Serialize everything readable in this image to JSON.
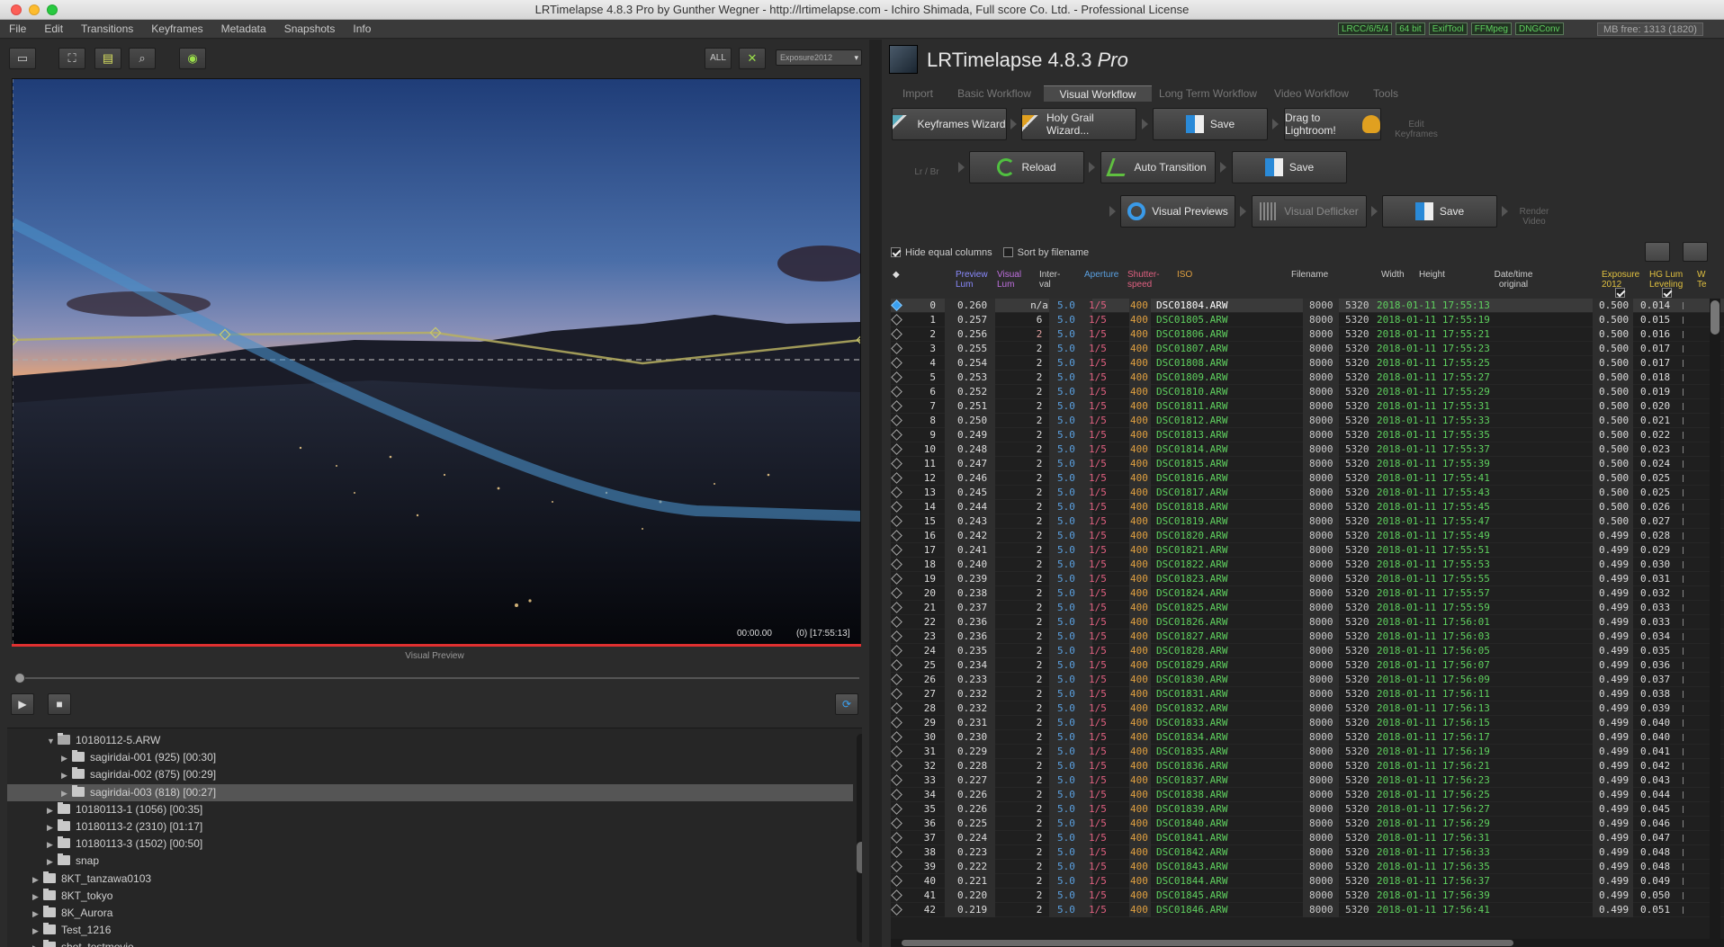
{
  "window": {
    "title": "LRTimelapse 4.8.3 Pro by Gunther Wegner - http://lrtimelapse.com - Ichiro Shimada, Full score Co. Ltd. - Professional License"
  },
  "menu": [
    "File",
    "Edit",
    "Transitions",
    "Keyframes",
    "Metadata",
    "Snapshots",
    "Info"
  ],
  "status_badges": [
    "LRCC/6/5/4",
    "64 bit",
    "ExifTool",
    "FFMpeg",
    "DNGConv"
  ],
  "memory": "MB free: 1313 (1820)",
  "left_toolbar": {
    "all_label": "ALL",
    "dropdown_value": "Exposure2012"
  },
  "preview": {
    "time": "00:00.00",
    "frame_info": "(0) [17:55:13]",
    "label": "Visual Preview",
    "slider_position": 0
  },
  "tree": [
    {
      "label": "10180112-5.ARW",
      "indent": 3,
      "open": true,
      "selected": false
    },
    {
      "label": "sagiridai-001 (925) [00:30]",
      "indent": 4,
      "open": false,
      "selected": false
    },
    {
      "label": "sagiridai-002 (875) [00:29]",
      "indent": 4,
      "open": false,
      "selected": false
    },
    {
      "label": "sagiridai-003 (818) [00:27]",
      "indent": 4,
      "open": false,
      "selected": true
    },
    {
      "label": "10180113-1 (1056) [00:35]",
      "indent": 3,
      "open": false,
      "selected": false
    },
    {
      "label": "10180113-2 (2310) [01:17]",
      "indent": 3,
      "open": false,
      "selected": false
    },
    {
      "label": "10180113-3 (1502) [00:50]",
      "indent": 3,
      "open": false,
      "selected": false
    },
    {
      "label": "snap",
      "indent": 3,
      "open": false,
      "selected": false
    },
    {
      "label": "8KT_tanzawa0103",
      "indent": 2,
      "open": false,
      "selected": false
    },
    {
      "label": "8KT_tokyo",
      "indent": 2,
      "open": false,
      "selected": false
    },
    {
      "label": "8K_Aurora",
      "indent": 2,
      "open": false,
      "selected": false
    },
    {
      "label": "Test_1216",
      "indent": 2,
      "open": false,
      "selected": false
    },
    {
      "label": "shot_testmovie",
      "indent": 2,
      "open": false,
      "selected": false
    }
  ],
  "app": {
    "name": "LRTimelapse 4.8.3",
    "edition": "Pro"
  },
  "workflow_tabs": [
    "Import",
    "Basic Workflow",
    "Visual Workflow",
    "Long Term Workflow",
    "Video Workflow",
    "Tools"
  ],
  "active_tab": "Visual Workflow",
  "workflow": {
    "keyframes_wizard": "Keyframes Wizard",
    "holy_grail_wizard": "Holy Grail Wizard...",
    "save1": "Save",
    "drag_to_lightroom": "Drag to Lightroom!",
    "edit_keyframes": "Edit Keyframes",
    "lr_br": "Lr / Br",
    "reload": "Reload",
    "auto_transition": "Auto Transition",
    "save2": "Save",
    "visual_previews": "Visual Previews",
    "visual_deflicker": "Visual Deflicker",
    "save3": "Save",
    "render_video": "Render Video"
  },
  "options": {
    "hide_equal_columns": "Hide equal columns",
    "hide_equal_checked": true,
    "sort_by_filename": "Sort by filename",
    "sort_checked": false
  },
  "table": {
    "headers": {
      "keyframe": "◆",
      "preview_lum": "Preview Lum",
      "visual_lum": "Visual Lum",
      "interval": "Inter- val",
      "aperture": "Aperture",
      "shutter": "Shutter- speed",
      "iso": "ISO",
      "filename": "Filename",
      "width": "Width",
      "height": "Height",
      "datetime": "Date/time original",
      "exposure": "Exposure 2012",
      "hglum": "HG Lum Leveling",
      "wb": "W Te"
    },
    "colors": {
      "preview_lum": "#8a8aff",
      "visual_lum": "#c070e0",
      "aperture": "#5aa0e0",
      "shutter": "#e06080",
      "iso": "#e0a040",
      "exposure": "#e0c040",
      "datetime_text": "#5fd05f"
    },
    "rows": [
      {
        "n": "0",
        "lum": "0.260",
        "int": "n/a",
        "ap": "5.0",
        "sh": "1/5",
        "iso": "400",
        "file": "DSC01804.ARW",
        "w": "8000",
        "h": "5320",
        "dt": "2018-01-11 17:55:13",
        "exp": "0.500",
        "hg": "0.014",
        "kf": true
      },
      {
        "n": "1",
        "lum": "0.257",
        "int": "6",
        "ap": "5.0",
        "sh": "1/5",
        "iso": "400",
        "file": "DSC01805.ARW",
        "w": "8000",
        "h": "5320",
        "dt": "2018-01-11 17:55:19",
        "exp": "0.500",
        "hg": "0.015",
        "kf": false
      },
      {
        "n": "2",
        "lum": "0.256",
        "int": "2",
        "ap": "5.0",
        "sh": "1/5",
        "iso": "400",
        "file": "DSC01806.ARW",
        "w": "8000",
        "h": "5320",
        "dt": "2018-01-11 17:55:21",
        "exp": "0.500",
        "hg": "0.016",
        "kf": false
      },
      {
        "n": "3",
        "lum": "0.255",
        "int": "2",
        "ap": "5.0",
        "sh": "1/5",
        "iso": "400",
        "file": "DSC01807.ARW",
        "w": "8000",
        "h": "5320",
        "dt": "2018-01-11 17:55:23",
        "exp": "0.500",
        "hg": "0.017",
        "kf": false
      },
      {
        "n": "4",
        "lum": "0.254",
        "int": "2",
        "ap": "5.0",
        "sh": "1/5",
        "iso": "400",
        "file": "DSC01808.ARW",
        "w": "8000",
        "h": "5320",
        "dt": "2018-01-11 17:55:25",
        "exp": "0.500",
        "hg": "0.017",
        "kf": false
      },
      {
        "n": "5",
        "lum": "0.253",
        "int": "2",
        "ap": "5.0",
        "sh": "1/5",
        "iso": "400",
        "file": "DSC01809.ARW",
        "w": "8000",
        "h": "5320",
        "dt": "2018-01-11 17:55:27",
        "exp": "0.500",
        "hg": "0.018",
        "kf": false
      },
      {
        "n": "6",
        "lum": "0.252",
        "int": "2",
        "ap": "5.0",
        "sh": "1/5",
        "iso": "400",
        "file": "DSC01810.ARW",
        "w": "8000",
        "h": "5320",
        "dt": "2018-01-11 17:55:29",
        "exp": "0.500",
        "hg": "0.019",
        "kf": false
      },
      {
        "n": "7",
        "lum": "0.251",
        "int": "2",
        "ap": "5.0",
        "sh": "1/5",
        "iso": "400",
        "file": "DSC01811.ARW",
        "w": "8000",
        "h": "5320",
        "dt": "2018-01-11 17:55:31",
        "exp": "0.500",
        "hg": "0.020",
        "kf": false
      },
      {
        "n": "8",
        "lum": "0.250",
        "int": "2",
        "ap": "5.0",
        "sh": "1/5",
        "iso": "400",
        "file": "DSC01812.ARW",
        "w": "8000",
        "h": "5320",
        "dt": "2018-01-11 17:55:33",
        "exp": "0.500",
        "hg": "0.021",
        "kf": false
      },
      {
        "n": "9",
        "lum": "0.249",
        "int": "2",
        "ap": "5.0",
        "sh": "1/5",
        "iso": "400",
        "file": "DSC01813.ARW",
        "w": "8000",
        "h": "5320",
        "dt": "2018-01-11 17:55:35",
        "exp": "0.500",
        "hg": "0.022",
        "kf": false
      },
      {
        "n": "10",
        "lum": "0.248",
        "int": "2",
        "ap": "5.0",
        "sh": "1/5",
        "iso": "400",
        "file": "DSC01814.ARW",
        "w": "8000",
        "h": "5320",
        "dt": "2018-01-11 17:55:37",
        "exp": "0.500",
        "hg": "0.023",
        "kf": false
      },
      {
        "n": "11",
        "lum": "0.247",
        "int": "2",
        "ap": "5.0",
        "sh": "1/5",
        "iso": "400",
        "file": "DSC01815.ARW",
        "w": "8000",
        "h": "5320",
        "dt": "2018-01-11 17:55:39",
        "exp": "0.500",
        "hg": "0.024",
        "kf": false
      },
      {
        "n": "12",
        "lum": "0.246",
        "int": "2",
        "ap": "5.0",
        "sh": "1/5",
        "iso": "400",
        "file": "DSC01816.ARW",
        "w": "8000",
        "h": "5320",
        "dt": "2018-01-11 17:55:41",
        "exp": "0.500",
        "hg": "0.025",
        "kf": false
      },
      {
        "n": "13",
        "lum": "0.245",
        "int": "2",
        "ap": "5.0",
        "sh": "1/5",
        "iso": "400",
        "file": "DSC01817.ARW",
        "w": "8000",
        "h": "5320",
        "dt": "2018-01-11 17:55:43",
        "exp": "0.500",
        "hg": "0.025",
        "kf": false
      },
      {
        "n": "14",
        "lum": "0.244",
        "int": "2",
        "ap": "5.0",
        "sh": "1/5",
        "iso": "400",
        "file": "DSC01818.ARW",
        "w": "8000",
        "h": "5320",
        "dt": "2018-01-11 17:55:45",
        "exp": "0.500",
        "hg": "0.026",
        "kf": false
      },
      {
        "n": "15",
        "lum": "0.243",
        "int": "2",
        "ap": "5.0",
        "sh": "1/5",
        "iso": "400",
        "file": "DSC01819.ARW",
        "w": "8000",
        "h": "5320",
        "dt": "2018-01-11 17:55:47",
        "exp": "0.500",
        "hg": "0.027",
        "kf": false
      },
      {
        "n": "16",
        "lum": "0.242",
        "int": "2",
        "ap": "5.0",
        "sh": "1/5",
        "iso": "400",
        "file": "DSC01820.ARW",
        "w": "8000",
        "h": "5320",
        "dt": "2018-01-11 17:55:49",
        "exp": "0.499",
        "hg": "0.028",
        "kf": false
      },
      {
        "n": "17",
        "lum": "0.241",
        "int": "2",
        "ap": "5.0",
        "sh": "1/5",
        "iso": "400",
        "file": "DSC01821.ARW",
        "w": "8000",
        "h": "5320",
        "dt": "2018-01-11 17:55:51",
        "exp": "0.499",
        "hg": "0.029",
        "kf": false
      },
      {
        "n": "18",
        "lum": "0.240",
        "int": "2",
        "ap": "5.0",
        "sh": "1/5",
        "iso": "400",
        "file": "DSC01822.ARW",
        "w": "8000",
        "h": "5320",
        "dt": "2018-01-11 17:55:53",
        "exp": "0.499",
        "hg": "0.030",
        "kf": false
      },
      {
        "n": "19",
        "lum": "0.239",
        "int": "2",
        "ap": "5.0",
        "sh": "1/5",
        "iso": "400",
        "file": "DSC01823.ARW",
        "w": "8000",
        "h": "5320",
        "dt": "2018-01-11 17:55:55",
        "exp": "0.499",
        "hg": "0.031",
        "kf": false
      },
      {
        "n": "20",
        "lum": "0.238",
        "int": "2",
        "ap": "5.0",
        "sh": "1/5",
        "iso": "400",
        "file": "DSC01824.ARW",
        "w": "8000",
        "h": "5320",
        "dt": "2018-01-11 17:55:57",
        "exp": "0.499",
        "hg": "0.032",
        "kf": false
      },
      {
        "n": "21",
        "lum": "0.237",
        "int": "2",
        "ap": "5.0",
        "sh": "1/5",
        "iso": "400",
        "file": "DSC01825.ARW",
        "w": "8000",
        "h": "5320",
        "dt": "2018-01-11 17:55:59",
        "exp": "0.499",
        "hg": "0.033",
        "kf": false
      },
      {
        "n": "22",
        "lum": "0.236",
        "int": "2",
        "ap": "5.0",
        "sh": "1/5",
        "iso": "400",
        "file": "DSC01826.ARW",
        "w": "8000",
        "h": "5320",
        "dt": "2018-01-11 17:56:01",
        "exp": "0.499",
        "hg": "0.033",
        "kf": false
      },
      {
        "n": "23",
        "lum": "0.236",
        "int": "2",
        "ap": "5.0",
        "sh": "1/5",
        "iso": "400",
        "file": "DSC01827.ARW",
        "w": "8000",
        "h": "5320",
        "dt": "2018-01-11 17:56:03",
        "exp": "0.499",
        "hg": "0.034",
        "kf": false
      },
      {
        "n": "24",
        "lum": "0.235",
        "int": "2",
        "ap": "5.0",
        "sh": "1/5",
        "iso": "400",
        "file": "DSC01828.ARW",
        "w": "8000",
        "h": "5320",
        "dt": "2018-01-11 17:56:05",
        "exp": "0.499",
        "hg": "0.035",
        "kf": false
      },
      {
        "n": "25",
        "lum": "0.234",
        "int": "2",
        "ap": "5.0",
        "sh": "1/5",
        "iso": "400",
        "file": "DSC01829.ARW",
        "w": "8000",
        "h": "5320",
        "dt": "2018-01-11 17:56:07",
        "exp": "0.499",
        "hg": "0.036",
        "kf": false
      },
      {
        "n": "26",
        "lum": "0.233",
        "int": "2",
        "ap": "5.0",
        "sh": "1/5",
        "iso": "400",
        "file": "DSC01830.ARW",
        "w": "8000",
        "h": "5320",
        "dt": "2018-01-11 17:56:09",
        "exp": "0.499",
        "hg": "0.037",
        "kf": false
      },
      {
        "n": "27",
        "lum": "0.232",
        "int": "2",
        "ap": "5.0",
        "sh": "1/5",
        "iso": "400",
        "file": "DSC01831.ARW",
        "w": "8000",
        "h": "5320",
        "dt": "2018-01-11 17:56:11",
        "exp": "0.499",
        "hg": "0.038",
        "kf": false
      },
      {
        "n": "28",
        "lum": "0.232",
        "int": "2",
        "ap": "5.0",
        "sh": "1/5",
        "iso": "400",
        "file": "DSC01832.ARW",
        "w": "8000",
        "h": "5320",
        "dt": "2018-01-11 17:56:13",
        "exp": "0.499",
        "hg": "0.039",
        "kf": false
      },
      {
        "n": "29",
        "lum": "0.231",
        "int": "2",
        "ap": "5.0",
        "sh": "1/5",
        "iso": "400",
        "file": "DSC01833.ARW",
        "w": "8000",
        "h": "5320",
        "dt": "2018-01-11 17:56:15",
        "exp": "0.499",
        "hg": "0.040",
        "kf": false
      },
      {
        "n": "30",
        "lum": "0.230",
        "int": "2",
        "ap": "5.0",
        "sh": "1/5",
        "iso": "400",
        "file": "DSC01834.ARW",
        "w": "8000",
        "h": "5320",
        "dt": "2018-01-11 17:56:17",
        "exp": "0.499",
        "hg": "0.040",
        "kf": false
      },
      {
        "n": "31",
        "lum": "0.229",
        "int": "2",
        "ap": "5.0",
        "sh": "1/5",
        "iso": "400",
        "file": "DSC01835.ARW",
        "w": "8000",
        "h": "5320",
        "dt": "2018-01-11 17:56:19",
        "exp": "0.499",
        "hg": "0.041",
        "kf": false
      },
      {
        "n": "32",
        "lum": "0.228",
        "int": "2",
        "ap": "5.0",
        "sh": "1/5",
        "iso": "400",
        "file": "DSC01836.ARW",
        "w": "8000",
        "h": "5320",
        "dt": "2018-01-11 17:56:21",
        "exp": "0.499",
        "hg": "0.042",
        "kf": false
      },
      {
        "n": "33",
        "lum": "0.227",
        "int": "2",
        "ap": "5.0",
        "sh": "1/5",
        "iso": "400",
        "file": "DSC01837.ARW",
        "w": "8000",
        "h": "5320",
        "dt": "2018-01-11 17:56:23",
        "exp": "0.499",
        "hg": "0.043",
        "kf": false
      },
      {
        "n": "34",
        "lum": "0.226",
        "int": "2",
        "ap": "5.0",
        "sh": "1/5",
        "iso": "400",
        "file": "DSC01838.ARW",
        "w": "8000",
        "h": "5320",
        "dt": "2018-01-11 17:56:25",
        "exp": "0.499",
        "hg": "0.044",
        "kf": false
      },
      {
        "n": "35",
        "lum": "0.226",
        "int": "2",
        "ap": "5.0",
        "sh": "1/5",
        "iso": "400",
        "file": "DSC01839.ARW",
        "w": "8000",
        "h": "5320",
        "dt": "2018-01-11 17:56:27",
        "exp": "0.499",
        "hg": "0.045",
        "kf": false
      },
      {
        "n": "36",
        "lum": "0.225",
        "int": "2",
        "ap": "5.0",
        "sh": "1/5",
        "iso": "400",
        "file": "DSC01840.ARW",
        "w": "8000",
        "h": "5320",
        "dt": "2018-01-11 17:56:29",
        "exp": "0.499",
        "hg": "0.046",
        "kf": false
      },
      {
        "n": "37",
        "lum": "0.224",
        "int": "2",
        "ap": "5.0",
        "sh": "1/5",
        "iso": "400",
        "file": "DSC01841.ARW",
        "w": "8000",
        "h": "5320",
        "dt": "2018-01-11 17:56:31",
        "exp": "0.499",
        "hg": "0.047",
        "kf": false
      },
      {
        "n": "38",
        "lum": "0.223",
        "int": "2",
        "ap": "5.0",
        "sh": "1/5",
        "iso": "400",
        "file": "DSC01842.ARW",
        "w": "8000",
        "h": "5320",
        "dt": "2018-01-11 17:56:33",
        "exp": "0.499",
        "hg": "0.048",
        "kf": false
      },
      {
        "n": "39",
        "lum": "0.222",
        "int": "2",
        "ap": "5.0",
        "sh": "1/5",
        "iso": "400",
        "file": "DSC01843.ARW",
        "w": "8000",
        "h": "5320",
        "dt": "2018-01-11 17:56:35",
        "exp": "0.499",
        "hg": "0.048",
        "kf": false
      },
      {
        "n": "40",
        "lum": "0.221",
        "int": "2",
        "ap": "5.0",
        "sh": "1/5",
        "iso": "400",
        "file": "DSC01844.ARW",
        "w": "8000",
        "h": "5320",
        "dt": "2018-01-11 17:56:37",
        "exp": "0.499",
        "hg": "0.049",
        "kf": false
      },
      {
        "n": "41",
        "lum": "0.220",
        "int": "2",
        "ap": "5.0",
        "sh": "1/5",
        "iso": "400",
        "file": "DSC01845.ARW",
        "w": "8000",
        "h": "5320",
        "dt": "2018-01-11 17:56:39",
        "exp": "0.499",
        "hg": "0.050",
        "kf": false
      },
      {
        "n": "42",
        "lum": "0.219",
        "int": "2",
        "ap": "5.0",
        "sh": "1/5",
        "iso": "400",
        "file": "DSC01846.ARW",
        "w": "8000",
        "h": "5320",
        "dt": "2018-01-11 17:56:41",
        "exp": "0.499",
        "hg": "0.051",
        "kf": false
      }
    ]
  }
}
